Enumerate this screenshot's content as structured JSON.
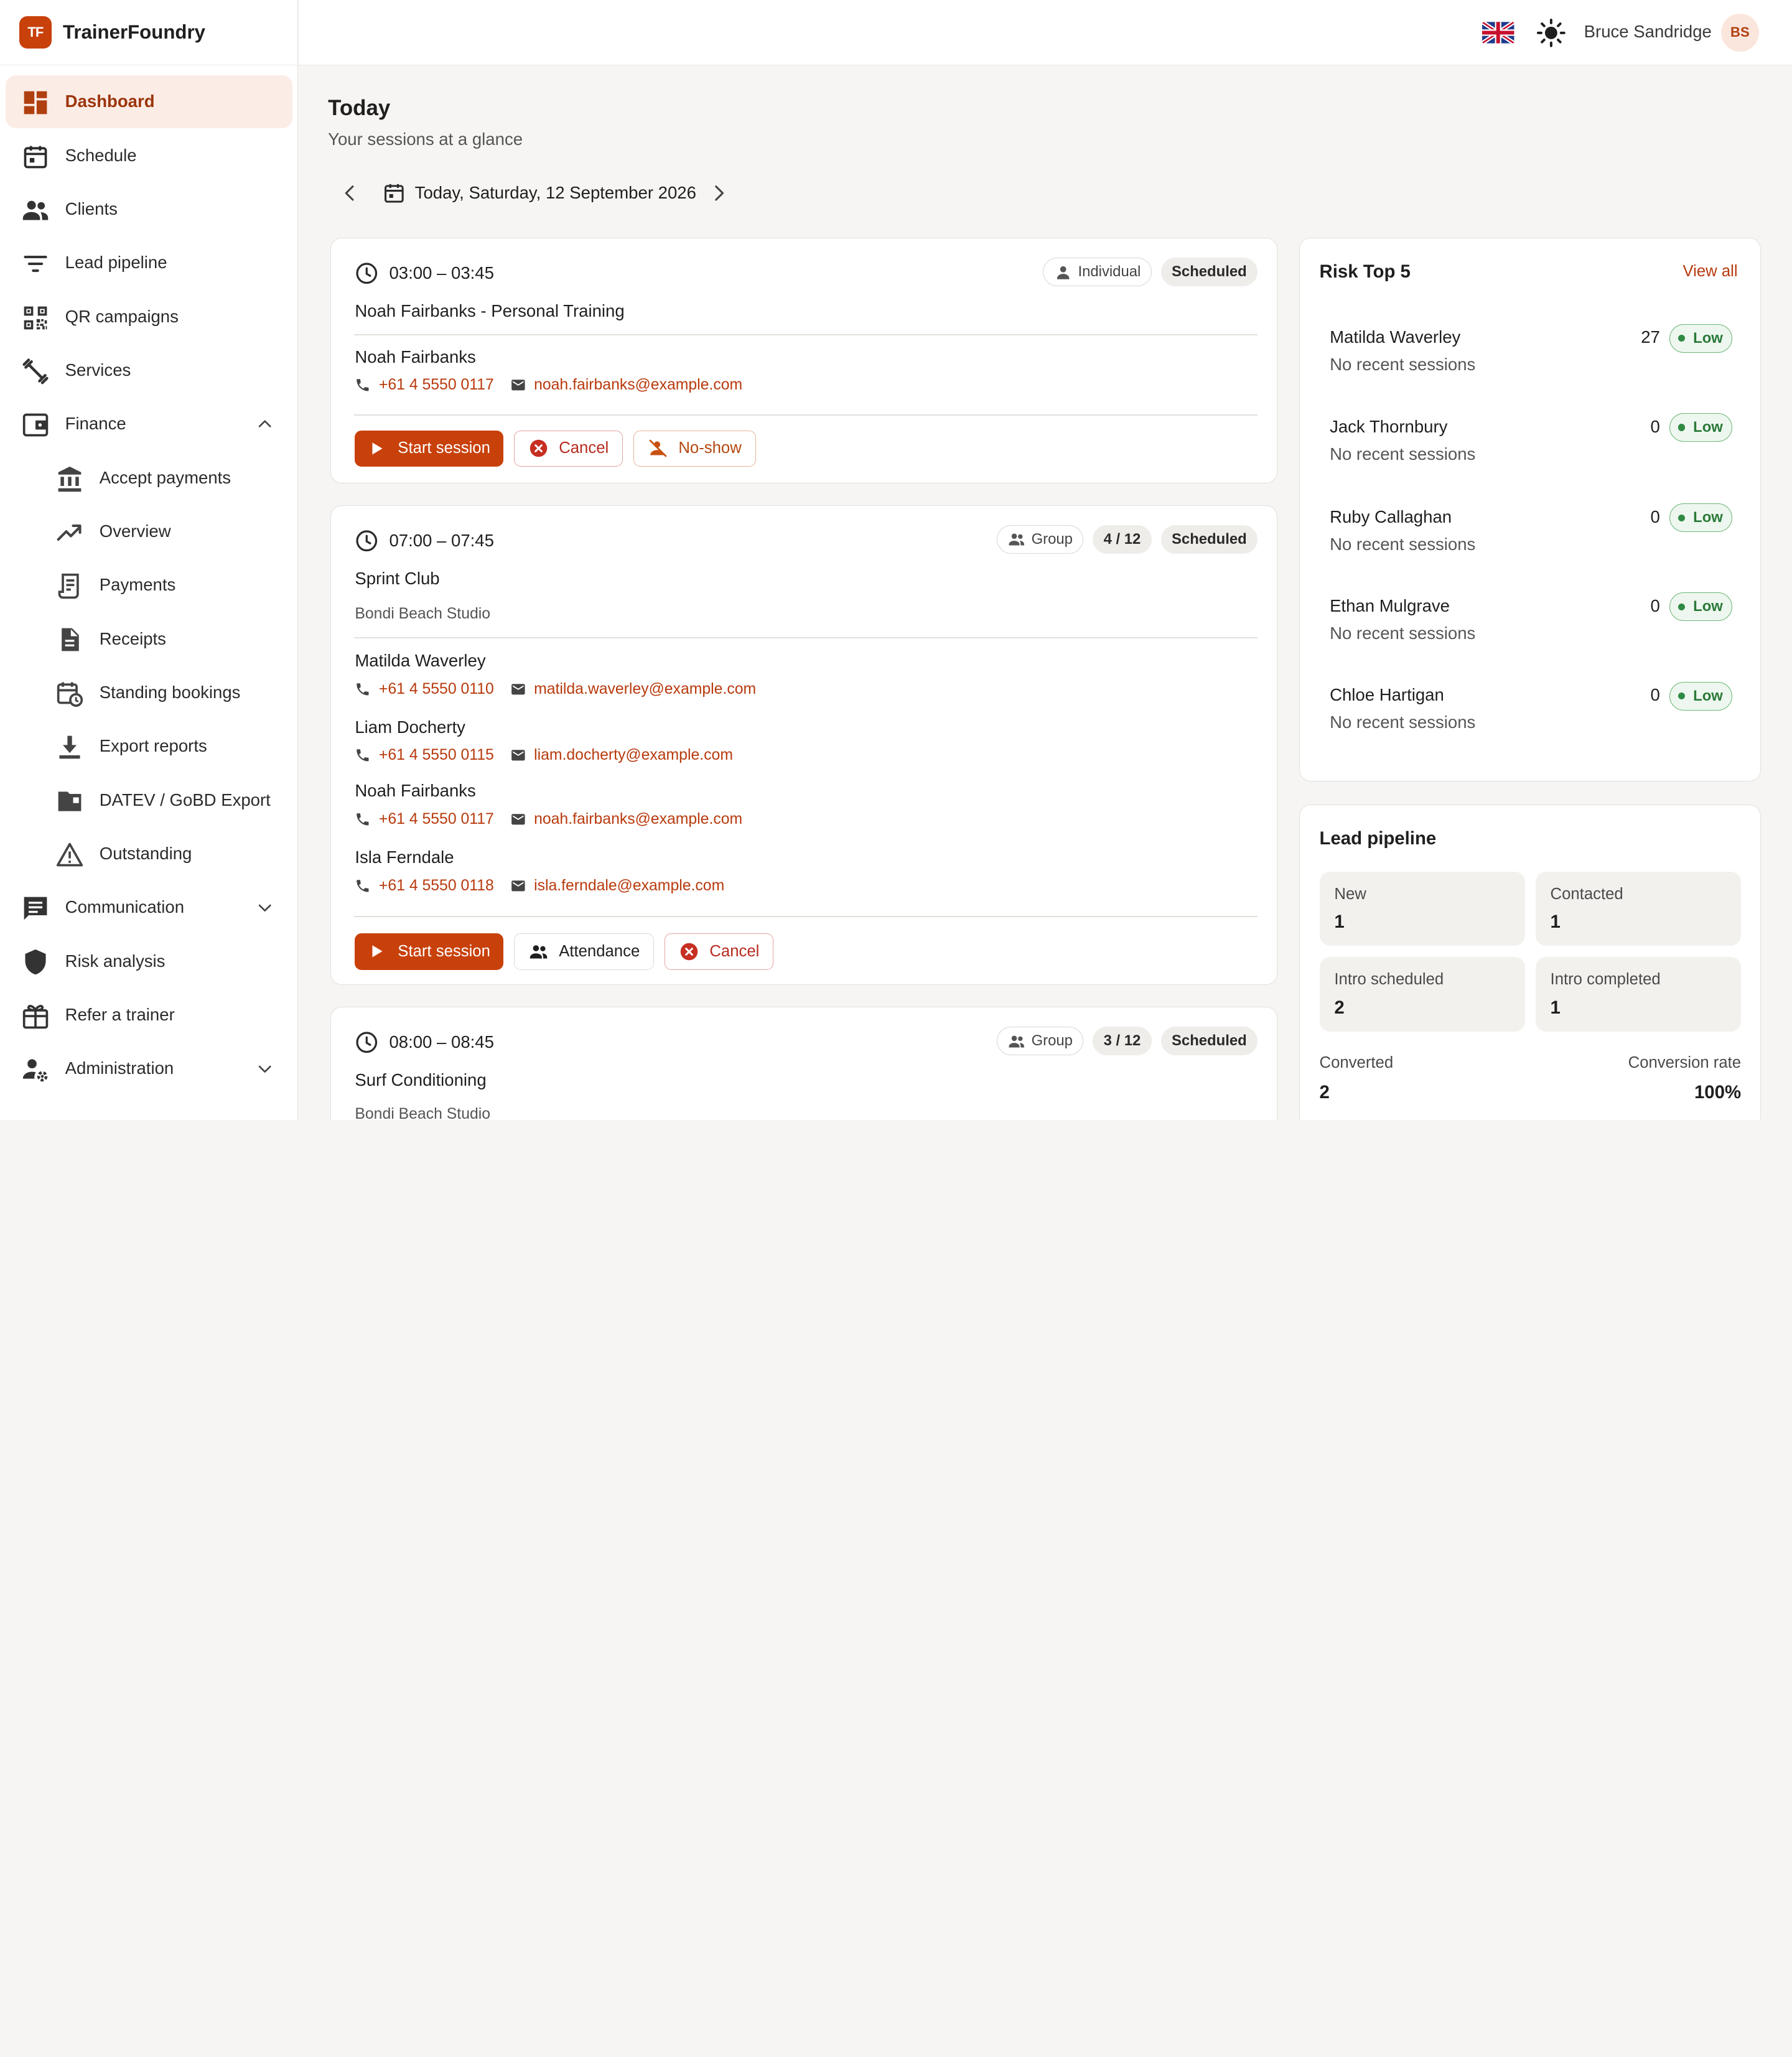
{
  "app": {
    "name": "TrainerFoundry",
    "logo_text": "TF",
    "accent": "#c8410b"
  },
  "topbar": {
    "user_name": "Bruce Sandridge",
    "user_initials": "BS",
    "language_icon": "uk-flag-icon",
    "theme_icon": "sun-icon"
  },
  "sidebar": {
    "items": [
      {
        "label": "Dashboard",
        "icon": "dashboard-icon",
        "active": true
      },
      {
        "label": "Schedule",
        "icon": "calendar-icon"
      },
      {
        "label": "Clients",
        "icon": "people-icon"
      },
      {
        "label": "Lead pipeline",
        "icon": "filter-icon"
      },
      {
        "label": "QR campaigns",
        "icon": "qr-icon"
      },
      {
        "label": "Services",
        "icon": "dumbbell-icon"
      },
      {
        "label": "Finance",
        "icon": "wallet-icon",
        "expanded": true
      },
      {
        "label": "Communication",
        "icon": "chat-icon",
        "expanded": false
      },
      {
        "label": "Risk analysis",
        "icon": "shield-icon"
      },
      {
        "label": "Refer a trainer",
        "icon": "gift-icon"
      },
      {
        "label": "Administration",
        "icon": "user-gear-icon",
        "expanded": false
      }
    ],
    "finance_sub": [
      {
        "label": "Accept payments",
        "icon": "bank-icon"
      },
      {
        "label": "Overview",
        "icon": "trending-up-icon"
      },
      {
        "label": "Payments",
        "icon": "receipt-long-icon"
      },
      {
        "label": "Receipts",
        "icon": "document-icon"
      },
      {
        "label": "Standing bookings",
        "icon": "calendar-repeat-icon"
      },
      {
        "label": "Export reports",
        "icon": "download-icon"
      },
      {
        "label": "DATEV / GoBD Export",
        "icon": "folder-icon"
      },
      {
        "label": "Outstanding",
        "icon": "warning-icon"
      }
    ]
  },
  "main": {
    "title": "Today",
    "subtitle": "Your sessions at a glance",
    "date_label": "Today, Saturday, 12 September 2026"
  },
  "sessions": [
    {
      "time": "03:00 – 03:45",
      "type": "Individual",
      "status": "Scheduled",
      "title": "Noah Fairbanks - Personal Training",
      "clients": [
        {
          "name": "Noah Fairbanks",
          "phone": "+61 4 5550 0117",
          "email": "noah.fairbanks@example.com"
        }
      ],
      "actions": [
        "Start session",
        "Cancel",
        "No-show"
      ]
    },
    {
      "time": "07:00 – 07:45",
      "type": "Group",
      "capacity": "4 / 12",
      "status": "Scheduled",
      "title": "Sprint Club",
      "location": "Bondi Beach Studio",
      "clients": [
        {
          "name": "Matilda Waverley",
          "phone": "+61 4 5550 0110",
          "email": "matilda.waverley@example.com"
        },
        {
          "name": "Liam Docherty",
          "phone": "+61 4 5550 0115",
          "email": "liam.docherty@example.com"
        },
        {
          "name": "Noah Fairbanks",
          "phone": "+61 4 5550 0117",
          "email": "noah.fairbanks@example.com"
        },
        {
          "name": "Isla Ferndale",
          "phone": "+61 4 5550 0118",
          "email": "isla.ferndale@example.com"
        }
      ],
      "actions": [
        "Start session",
        "Attendance",
        "Cancel"
      ]
    },
    {
      "time": "08:00 – 08:45",
      "type": "Group",
      "capacity": "3 / 12",
      "status": "Scheduled",
      "title": "Surf Conditioning",
      "location": "Bondi Beach Studio"
    }
  ],
  "risk": {
    "title": "Risk Top 5",
    "view_all": "View all",
    "rows": [
      {
        "name": "Matilda Waverley",
        "sub": "No recent sessions",
        "score": "27",
        "level": "Low"
      },
      {
        "name": "Jack Thornbury",
        "sub": "No recent sessions",
        "score": "0",
        "level": "Low"
      },
      {
        "name": "Ruby Callaghan",
        "sub": "No recent sessions",
        "score": "0",
        "level": "Low"
      },
      {
        "name": "Ethan Mulgrave",
        "sub": "No recent sessions",
        "score": "0",
        "level": "Low"
      },
      {
        "name": "Chloe Hartigan",
        "sub": "No recent sessions",
        "score": "0",
        "level": "Low"
      }
    ]
  },
  "lead_pipeline": {
    "title": "Lead pipeline",
    "tiles": [
      {
        "label": "New",
        "value": "1"
      },
      {
        "label": "Contacted",
        "value": "1"
      },
      {
        "label": "Intro scheduled",
        "value": "2"
      },
      {
        "label": "Intro completed",
        "value": "1"
      }
    ],
    "converted_label": "Converted",
    "converted_value": "2",
    "rate_label": "Conversion rate",
    "rate_value": "100%"
  }
}
